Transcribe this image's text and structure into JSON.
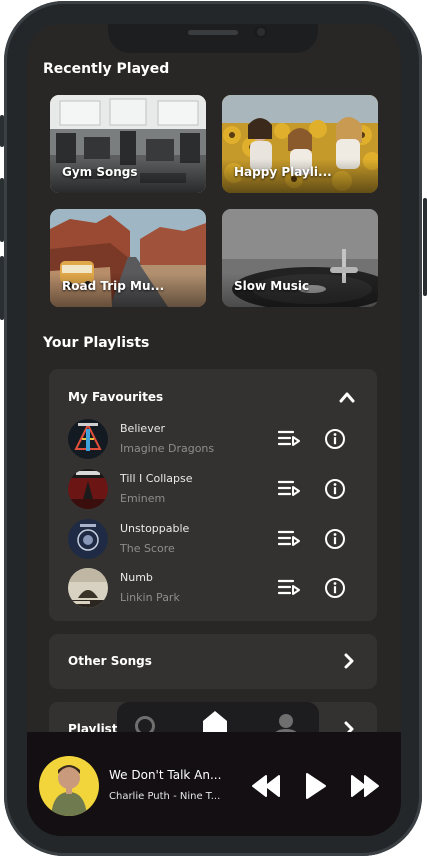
{
  "recently_played": {
    "title": "Recently Played",
    "tiles": [
      {
        "label": "Gym Songs"
      },
      {
        "label": "Happy Playli..."
      },
      {
        "label": "Road Trip Mu..."
      },
      {
        "label": "Slow Music"
      }
    ]
  },
  "your_playlists": {
    "title": "Your Playlists",
    "expanded": {
      "title": "My Favourites",
      "songs": [
        {
          "title": "Believer",
          "artist": "Imagine Dragons"
        },
        {
          "title": "Till I Collapse",
          "artist": "Eminem"
        },
        {
          "title": "Unstoppable",
          "artist": "The Score"
        },
        {
          "title": "Numb",
          "artist": "Linkin Park"
        }
      ]
    },
    "other": {
      "title": "Other Songs"
    },
    "partial": {
      "title": "Playlist"
    }
  },
  "now_playing": {
    "title": "We Don't Talk An...",
    "subtitle": "Charlie Puth - Nine T..."
  },
  "icons": [
    "search-icon",
    "home-icon",
    "profile-icon",
    "queue-icon",
    "info-icon",
    "chevron-up-icon",
    "chevron-right-icon",
    "previous-icon",
    "play-icon",
    "next-icon"
  ],
  "colors": {
    "screen": "#282726",
    "card": "#333230",
    "player": "#130f12",
    "frame": "#23272a"
  }
}
